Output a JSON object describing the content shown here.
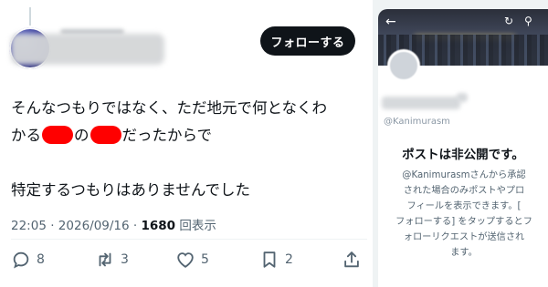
{
  "tweet": {
    "follow_label": "フォローする",
    "text_lines": [
      "そんなつもりではなく、ただ地元で何となくわ",
      "だったからで",
      "特定するつもりはありませんでした"
    ],
    "text_line2_prefix": "かる",
    "text_line2_mid": "の",
    "time": "22:05",
    "date": "2026/09/16",
    "views_count": "1680",
    "views_label": "回表示",
    "reply_count": "8",
    "repost_count": "3",
    "like_count": "5",
    "bookmark_count": "2"
  },
  "profile": {
    "handle": "@Kanimurasm",
    "private_title": "ポストは非公開です。",
    "private_lines": [
      "@Kanimurasmさんから承認",
      "された場合のみポストやプロ",
      "フィールを表示できます。[",
      "フォローする] をタップするとフ",
      "ォローリクエストが送信され",
      "ます。"
    ]
  },
  "icons": [
    "back-arrow-icon",
    "refresh-icon",
    "search-icon",
    "reply-icon",
    "repost-icon",
    "like-icon",
    "bookmark-icon",
    "share-icon"
  ],
  "colors": {
    "redaction": "#ff0000",
    "follow_button": "#0f1419",
    "muted_text": "#536471"
  }
}
